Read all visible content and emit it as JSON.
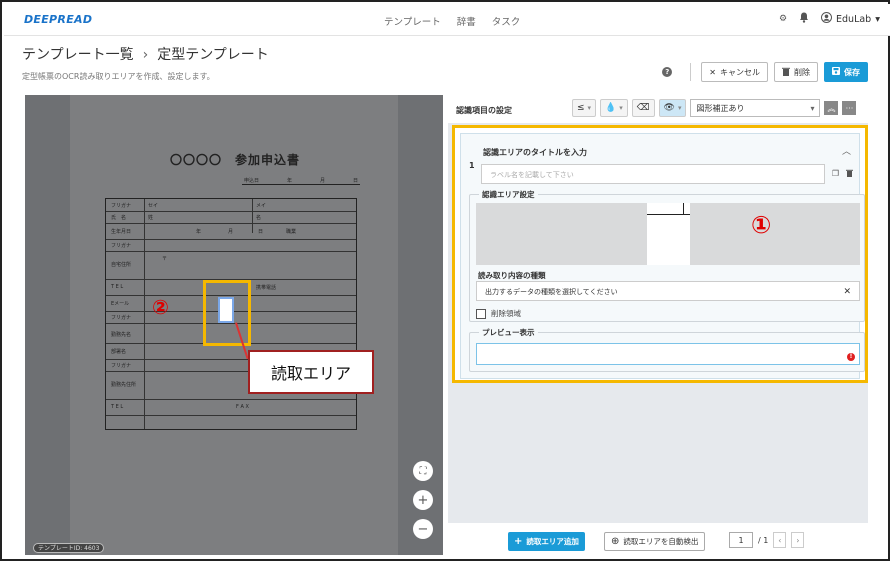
{
  "app": {
    "logo": "DEEPREAD",
    "nav": [
      "テンプレート",
      "辞書",
      "タスク"
    ],
    "user": "EduLab"
  },
  "header": {
    "breadcrumb_parent": "テンプレート一覧",
    "breadcrumb_sep": "›",
    "breadcrumb_current": "定型テンプレート",
    "subtitle": "定型帳票のOCR読み取りエリアを作成、設定します。",
    "cancel_label": "キャンセル",
    "delete_label": "削除",
    "save_label": "保存"
  },
  "viewer": {
    "doc_title": "〇〇〇〇　参加申込書",
    "date_labels": [
      "申込日",
      "年",
      "月",
      "日"
    ],
    "form_labels": [
      "フリガナ",
      "氏　名",
      "生年月日",
      "フリガナ",
      "自宅住所",
      "T E L",
      "Eメール",
      "フリガナ",
      "勤務先名",
      "部署名",
      "フリガナ",
      "勤務先住所",
      "T E L"
    ],
    "form_inline": {
      "sei": "セイ",
      "mei": "メイ",
      "shi": "姓",
      "na": "名",
      "nen": "年",
      "tsuki": "月",
      "hi": "日",
      "shokugyo": "職業",
      "postal": "〒",
      "mobile": "携帯電話",
      "fax": "F A X"
    },
    "marker_2": "②",
    "callout_text": "読取エリア",
    "template_id": "テンプレートID: 4603"
  },
  "panel": {
    "section_title": "認識項目の設定",
    "toolbar": {
      "filter_symbol": "≤",
      "correction_select": "図形補正あり"
    },
    "card": {
      "index": "1",
      "title": "認識エリアのタイトルを入力",
      "label_placeholder": "ラベル名を記載して下さい",
      "area_legend": "認識エリア設定",
      "marker_1": "①",
      "kind_label": "読み取り内容の種類",
      "kind_placeholder": "出力するデータの種類を選択してください",
      "delete_area_label": "削除領域",
      "preview_legend": "プレビュー表示"
    },
    "bottom": {
      "add_label": "読取エリア追加",
      "auto_label": "読取エリアを自動検出",
      "page_current": "1",
      "page_total": "/ 1"
    }
  },
  "colors": {
    "brand": "#1a73c9",
    "primary_button": "#1a9bd7",
    "highlight": "#f5b800",
    "marker_red": "#e00000"
  }
}
